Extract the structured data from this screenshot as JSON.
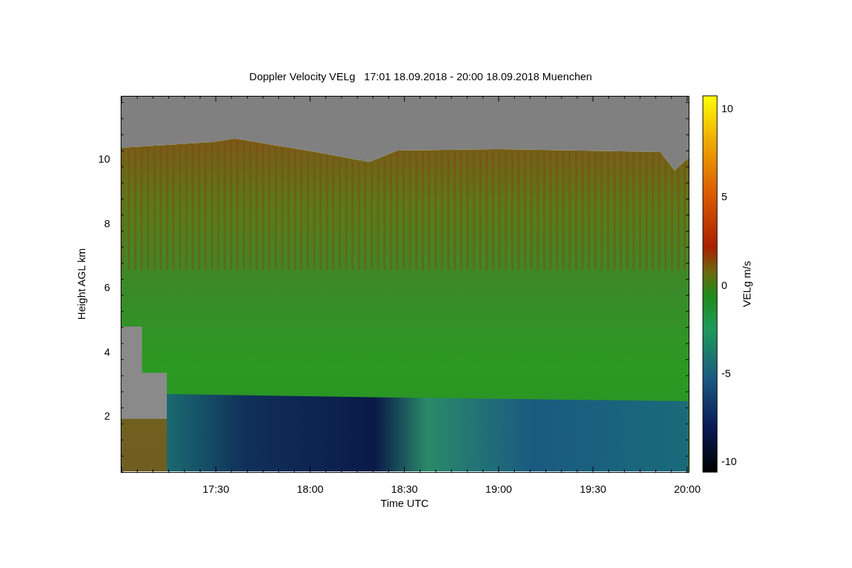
{
  "title": "Doppler Velocity VELg   17:01 18.09.2018 - 20:00 18.09.2018 Muenchen",
  "y_axis": {
    "label": "Height AGL km",
    "ticks": [
      "10",
      "8",
      "6",
      "4",
      "2"
    ]
  },
  "x_axis": {
    "label": "Time UTC",
    "ticks": [
      "17:30",
      "18:00",
      "18:30",
      "19:00",
      "19:30",
      "20:00"
    ]
  },
  "colorbar": {
    "label": "VELg m/s",
    "ticks": [
      "10",
      "5",
      "0",
      "-5",
      "-10"
    ]
  }
}
